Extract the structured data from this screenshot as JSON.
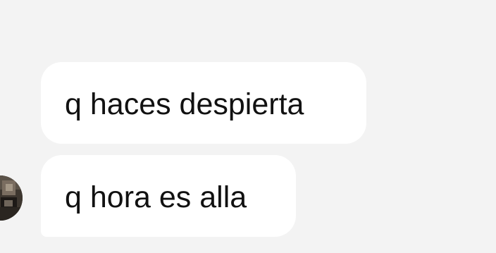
{
  "conversation": {
    "messages": [
      {
        "sender": "contact",
        "text": "q haces despierta"
      },
      {
        "sender": "contact",
        "text": "q hora es alla"
      }
    ]
  },
  "colors": {
    "background": "#f3f3f3",
    "bubble": "#ffffff",
    "text": "#111111"
  },
  "icons": {
    "avatar": "profile-photo"
  }
}
